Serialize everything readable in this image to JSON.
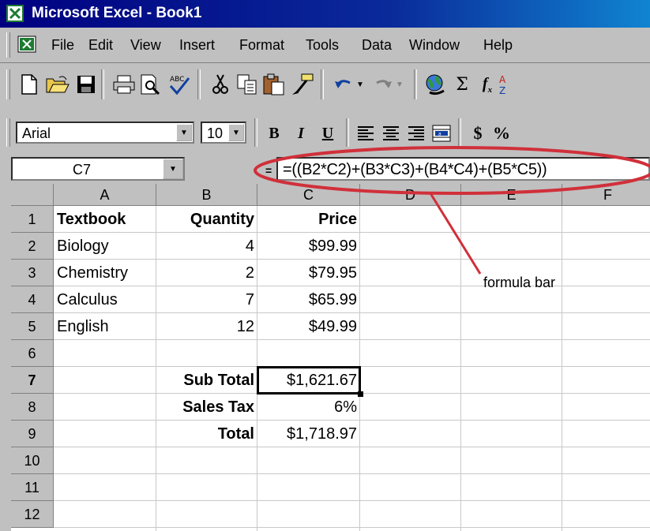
{
  "window": {
    "title": "Microsoft Excel - Book1"
  },
  "menu": [
    "File",
    "Edit",
    "View",
    "Insert",
    "Format",
    "Tools",
    "Data",
    "Window",
    "Help"
  ],
  "toolbar_icons": [
    "new-file-icon",
    "open-folder-icon",
    "save-icon",
    "print-icon",
    "print-preview-icon",
    "spelling-icon",
    "cut-icon",
    "copy-icon",
    "paste-icon",
    "format-painter-icon",
    "undo-icon",
    "redo-icon",
    "hyperlink-icon",
    "autosum-icon",
    "function-icon",
    "sort-icon"
  ],
  "format": {
    "font": "Arial",
    "size": "10",
    "bold": "B",
    "italic": "I",
    "underline": "U",
    "currency": "$",
    "percent": "%"
  },
  "formula_bar": {
    "name_box": "C7",
    "formula": "=((B2*C2)+(B3*C3)+(B4*C4)+(B5*C5))"
  },
  "columns": [
    "A",
    "B",
    "C",
    "D",
    "E",
    "F"
  ],
  "rows": [
    "1",
    "2",
    "3",
    "4",
    "5",
    "6",
    "7",
    "8",
    "9",
    "10",
    "11",
    "12"
  ],
  "active_row": "7",
  "cells": {
    "A1": "Textbook",
    "B1": "Quantity",
    "C1": "Price",
    "A2": "Biology",
    "B2": "4",
    "C2": "$99.99",
    "A3": "Chemistry",
    "B3": "2",
    "C3": "$79.95",
    "A4": "Calculus",
    "B4": "7",
    "C4": "$65.99",
    "A5": "English",
    "B5": "12",
    "C5": "$49.99",
    "B7": "Sub Total",
    "C7": "$1,621.67",
    "B8": "Sales Tax",
    "C8": "6%",
    "B9": "Total",
    "C9": "$1,718.97"
  },
  "annotation": {
    "label": "formula bar",
    "color": "#d0303a"
  },
  "colors": {
    "title_bar": "#000080",
    "chrome": "#c0c0c0",
    "grid_line": "#c8c8c8"
  }
}
